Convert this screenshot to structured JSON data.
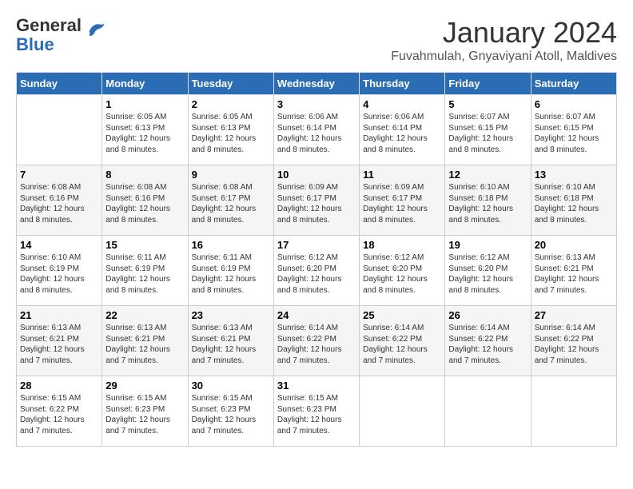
{
  "header": {
    "logo": {
      "line1": "General",
      "line2": "Blue"
    },
    "title": "January 2024",
    "subtitle": "Fuvahmulah, Gnyaviyani Atoll, Maldives"
  },
  "weekdays": [
    "Sunday",
    "Monday",
    "Tuesday",
    "Wednesday",
    "Thursday",
    "Friday",
    "Saturday"
  ],
  "weeks": [
    [
      {
        "day": "",
        "sunrise": "",
        "sunset": "",
        "daylight": ""
      },
      {
        "day": "1",
        "sunrise": "Sunrise: 6:05 AM",
        "sunset": "Sunset: 6:13 PM",
        "daylight": "Daylight: 12 hours and 8 minutes."
      },
      {
        "day": "2",
        "sunrise": "Sunrise: 6:05 AM",
        "sunset": "Sunset: 6:13 PM",
        "daylight": "Daylight: 12 hours and 8 minutes."
      },
      {
        "day": "3",
        "sunrise": "Sunrise: 6:06 AM",
        "sunset": "Sunset: 6:14 PM",
        "daylight": "Daylight: 12 hours and 8 minutes."
      },
      {
        "day": "4",
        "sunrise": "Sunrise: 6:06 AM",
        "sunset": "Sunset: 6:14 PM",
        "daylight": "Daylight: 12 hours and 8 minutes."
      },
      {
        "day": "5",
        "sunrise": "Sunrise: 6:07 AM",
        "sunset": "Sunset: 6:15 PM",
        "daylight": "Daylight: 12 hours and 8 minutes."
      },
      {
        "day": "6",
        "sunrise": "Sunrise: 6:07 AM",
        "sunset": "Sunset: 6:15 PM",
        "daylight": "Daylight: 12 hours and 8 minutes."
      }
    ],
    [
      {
        "day": "7",
        "sunrise": "Sunrise: 6:08 AM",
        "sunset": "Sunset: 6:16 PM",
        "daylight": "Daylight: 12 hours and 8 minutes."
      },
      {
        "day": "8",
        "sunrise": "Sunrise: 6:08 AM",
        "sunset": "Sunset: 6:16 PM",
        "daylight": "Daylight: 12 hours and 8 minutes."
      },
      {
        "day": "9",
        "sunrise": "Sunrise: 6:08 AM",
        "sunset": "Sunset: 6:17 PM",
        "daylight": "Daylight: 12 hours and 8 minutes."
      },
      {
        "day": "10",
        "sunrise": "Sunrise: 6:09 AM",
        "sunset": "Sunset: 6:17 PM",
        "daylight": "Daylight: 12 hours and 8 minutes."
      },
      {
        "day": "11",
        "sunrise": "Sunrise: 6:09 AM",
        "sunset": "Sunset: 6:17 PM",
        "daylight": "Daylight: 12 hours and 8 minutes."
      },
      {
        "day": "12",
        "sunrise": "Sunrise: 6:10 AM",
        "sunset": "Sunset: 6:18 PM",
        "daylight": "Daylight: 12 hours and 8 minutes."
      },
      {
        "day": "13",
        "sunrise": "Sunrise: 6:10 AM",
        "sunset": "Sunset: 6:18 PM",
        "daylight": "Daylight: 12 hours and 8 minutes."
      }
    ],
    [
      {
        "day": "14",
        "sunrise": "Sunrise: 6:10 AM",
        "sunset": "Sunset: 6:19 PM",
        "daylight": "Daylight: 12 hours and 8 minutes."
      },
      {
        "day": "15",
        "sunrise": "Sunrise: 6:11 AM",
        "sunset": "Sunset: 6:19 PM",
        "daylight": "Daylight: 12 hours and 8 minutes."
      },
      {
        "day": "16",
        "sunrise": "Sunrise: 6:11 AM",
        "sunset": "Sunset: 6:19 PM",
        "daylight": "Daylight: 12 hours and 8 minutes."
      },
      {
        "day": "17",
        "sunrise": "Sunrise: 6:12 AM",
        "sunset": "Sunset: 6:20 PM",
        "daylight": "Daylight: 12 hours and 8 minutes."
      },
      {
        "day": "18",
        "sunrise": "Sunrise: 6:12 AM",
        "sunset": "Sunset: 6:20 PM",
        "daylight": "Daylight: 12 hours and 8 minutes."
      },
      {
        "day": "19",
        "sunrise": "Sunrise: 6:12 AM",
        "sunset": "Sunset: 6:20 PM",
        "daylight": "Daylight: 12 hours and 8 minutes."
      },
      {
        "day": "20",
        "sunrise": "Sunrise: 6:13 AM",
        "sunset": "Sunset: 6:21 PM",
        "daylight": "Daylight: 12 hours and 7 minutes."
      }
    ],
    [
      {
        "day": "21",
        "sunrise": "Sunrise: 6:13 AM",
        "sunset": "Sunset: 6:21 PM",
        "daylight": "Daylight: 12 hours and 7 minutes."
      },
      {
        "day": "22",
        "sunrise": "Sunrise: 6:13 AM",
        "sunset": "Sunset: 6:21 PM",
        "daylight": "Daylight: 12 hours and 7 minutes."
      },
      {
        "day": "23",
        "sunrise": "Sunrise: 6:13 AM",
        "sunset": "Sunset: 6:21 PM",
        "daylight": "Daylight: 12 hours and 7 minutes."
      },
      {
        "day": "24",
        "sunrise": "Sunrise: 6:14 AM",
        "sunset": "Sunset: 6:22 PM",
        "daylight": "Daylight: 12 hours and 7 minutes."
      },
      {
        "day": "25",
        "sunrise": "Sunrise: 6:14 AM",
        "sunset": "Sunset: 6:22 PM",
        "daylight": "Daylight: 12 hours and 7 minutes."
      },
      {
        "day": "26",
        "sunrise": "Sunrise: 6:14 AM",
        "sunset": "Sunset: 6:22 PM",
        "daylight": "Daylight: 12 hours and 7 minutes."
      },
      {
        "day": "27",
        "sunrise": "Sunrise: 6:14 AM",
        "sunset": "Sunset: 6:22 PM",
        "daylight": "Daylight: 12 hours and 7 minutes."
      }
    ],
    [
      {
        "day": "28",
        "sunrise": "Sunrise: 6:15 AM",
        "sunset": "Sunset: 6:22 PM",
        "daylight": "Daylight: 12 hours and 7 minutes."
      },
      {
        "day": "29",
        "sunrise": "Sunrise: 6:15 AM",
        "sunset": "Sunset: 6:23 PM",
        "daylight": "Daylight: 12 hours and 7 minutes."
      },
      {
        "day": "30",
        "sunrise": "Sunrise: 6:15 AM",
        "sunset": "Sunset: 6:23 PM",
        "daylight": "Daylight: 12 hours and 7 minutes."
      },
      {
        "day": "31",
        "sunrise": "Sunrise: 6:15 AM",
        "sunset": "Sunset: 6:23 PM",
        "daylight": "Daylight: 12 hours and 7 minutes."
      },
      {
        "day": "",
        "sunrise": "",
        "sunset": "",
        "daylight": ""
      },
      {
        "day": "",
        "sunrise": "",
        "sunset": "",
        "daylight": ""
      },
      {
        "day": "",
        "sunrise": "",
        "sunset": "",
        "daylight": ""
      }
    ]
  ]
}
